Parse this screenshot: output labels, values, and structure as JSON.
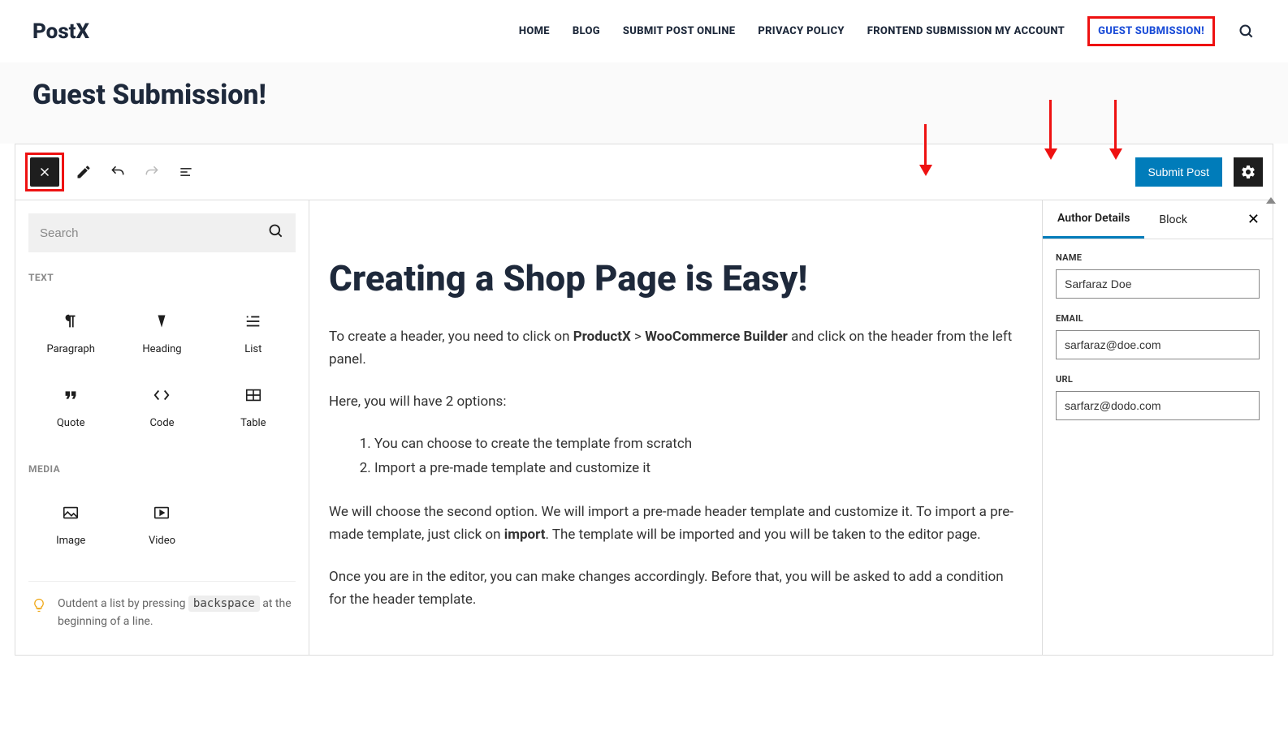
{
  "site": {
    "logo": "PostX"
  },
  "nav": {
    "items": [
      {
        "label": "HOME"
      },
      {
        "label": "BLOG"
      },
      {
        "label": "SUBMIT POST ONLINE"
      },
      {
        "label": "PRIVACY POLICY"
      },
      {
        "label": "FRONTEND SUBMISSION MY ACCOUNT"
      },
      {
        "label": "GUEST SUBMISSION!"
      }
    ]
  },
  "page": {
    "title": "Guest Submission!"
  },
  "toolbar": {
    "submit_label": "Submit Post"
  },
  "inserter": {
    "search_placeholder": "Search",
    "sections": {
      "text": {
        "label": "TEXT",
        "blocks": [
          {
            "label": "Paragraph"
          },
          {
            "label": "Heading"
          },
          {
            "label": "List"
          },
          {
            "label": "Quote"
          },
          {
            "label": "Code"
          },
          {
            "label": "Table"
          }
        ]
      },
      "media": {
        "label": "MEDIA",
        "blocks": [
          {
            "label": "Image"
          },
          {
            "label": "Video"
          }
        ]
      }
    },
    "tip_pre": "Outdent a list by pressing ",
    "tip_kbd": "backspace",
    "tip_post": " at the beginning of a line."
  },
  "content": {
    "title": "Creating a Shop Page is Easy!",
    "p1_a": "To create a header, you need to click on ",
    "p1_b1": "ProductX",
    "p1_c": " > ",
    "p1_b2": "WooCommerce Builder",
    "p1_d": " and click on the header from the left panel.",
    "p2": "Here, you will have 2 options:",
    "li1": "You can choose to create the template from scratch",
    "li2": "Import a pre-made template and customize it",
    "p3_a": "We will choose the second option. We will import a pre-made header template and customize it. To import a pre-made template, just click on ",
    "p3_b": "import",
    "p3_c": ". The template will be imported and you will be taken to the editor page.",
    "p4": "Once you are in the editor, you can make changes accordingly. Before that, you will be asked to add a condition for the header template."
  },
  "sidebar": {
    "tabs": {
      "author": "Author Details",
      "block": "Block"
    },
    "fields": {
      "name": {
        "label": "NAME",
        "value": "Sarfaraz Doe"
      },
      "email": {
        "label": "EMAIL",
        "value": "sarfaraz@doe.com"
      },
      "url": {
        "label": "URL",
        "value": "sarfarz@dodo.com"
      }
    }
  }
}
